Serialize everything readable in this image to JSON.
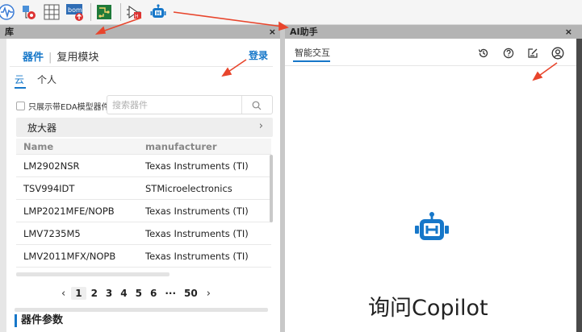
{
  "toolbar": {
    "icons": [
      "waveform-icon",
      "component-link-icon",
      "table-grid-icon",
      "bom-upload-icon",
      "pcb-icon",
      "schematic-symbol-icon",
      "ai-robot-icon"
    ],
    "bom_label": "bom"
  },
  "library_panel": {
    "title": "库",
    "close_label": "×",
    "tabs": [
      "器件",
      "复用模块"
    ],
    "tab_separator": "|",
    "login_label": "登录",
    "scope_tabs": [
      "云",
      "个人"
    ],
    "filter_label": "只展示带EDA模型器件",
    "search_placeholder": "搜索器件",
    "category": "放大器",
    "table": {
      "headers": [
        "Name",
        "manufacturer"
      ],
      "rows": [
        [
          "LM2902NSR",
          "Texas Instruments (TI)"
        ],
        [
          "TSV994IDT",
          "STMicroelectronics"
        ],
        [
          "LMP2021MFE/NOPB",
          "Texas Instruments (TI)"
        ],
        [
          "LMV7235M5",
          "Texas Instruments (TI)"
        ],
        [
          "LMV2011MFX/NOPB",
          "Texas Instruments (TI)"
        ]
      ]
    },
    "pagination": {
      "prev": "‹",
      "pages": [
        "1",
        "2",
        "3",
        "4",
        "5",
        "6"
      ],
      "ellipsis": "···",
      "last": "50",
      "next": "›",
      "current": "1"
    },
    "params_title": "器件参数"
  },
  "ai_panel": {
    "title": "AI助手",
    "close_label": "×",
    "tab": "智能交互",
    "tools": [
      "history-icon",
      "help-icon",
      "edit-icon",
      "user-avatar-icon"
    ],
    "headline": "询问Copilot"
  },
  "colors": {
    "accent": "#1677c9",
    "annotation": "#e8452c"
  }
}
